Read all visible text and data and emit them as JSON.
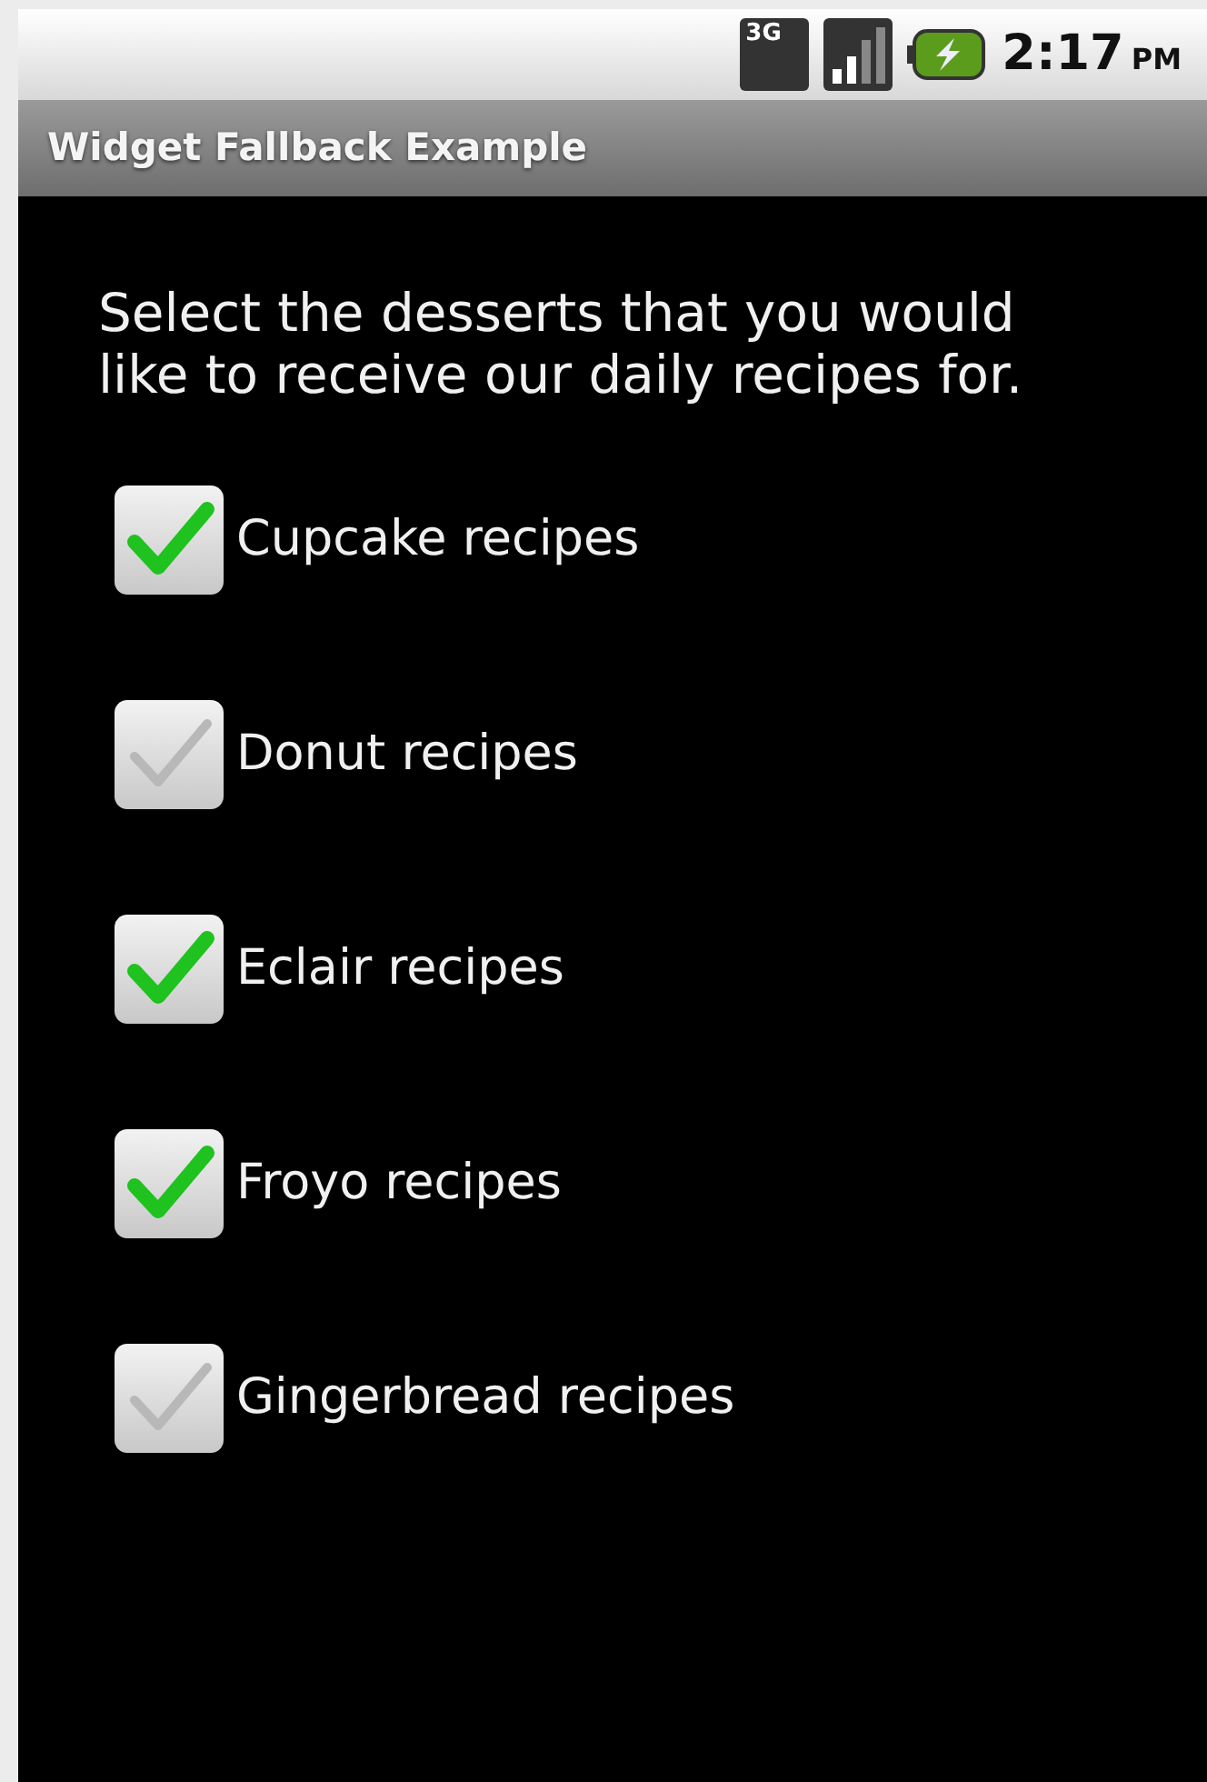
{
  "status_bar": {
    "network_type": "3G",
    "time": "2:17",
    "meridiem": "PM"
  },
  "title_bar": {
    "title": "Widget Fallback Example"
  },
  "prompt": "Select the desserts that you would like to receive our daily recipes for.",
  "options": [
    {
      "label": "Cupcake recipes",
      "checked": true
    },
    {
      "label": "Donut recipes",
      "checked": false
    },
    {
      "label": "Eclair recipes",
      "checked": true
    },
    {
      "label": "Froyo recipes",
      "checked": true
    },
    {
      "label": "Gingerbread recipes",
      "checked": false
    }
  ]
}
